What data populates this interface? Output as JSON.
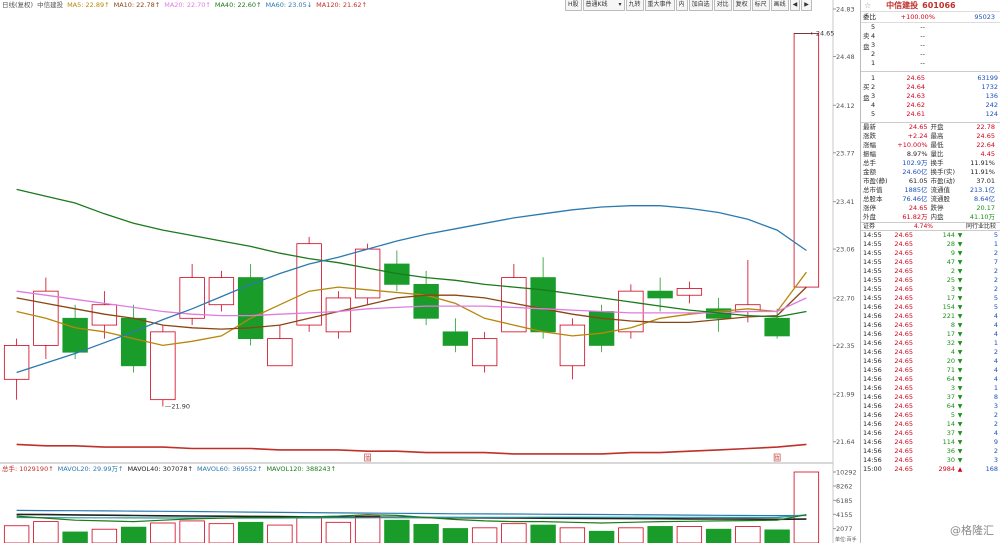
{
  "window": {
    "title": "日线(复权) 中信建投"
  },
  "legend_top": [
    {
      "text": "日线(复权)",
      "color": "#555555"
    },
    {
      "text": "中信建投",
      "color": "#555555"
    },
    {
      "text": "MA5: 22.89↑",
      "color": "#b8860b"
    },
    {
      "text": "MA10: 22.78↑",
      "color": "#8b4513"
    },
    {
      "text": "MA20: 22.70↑",
      "color": "#e07be0"
    },
    {
      "text": "MA40: 22.60↑",
      "color": "#1b7a1b"
    },
    {
      "text": "MA60: 23.05↓",
      "color": "#2a7ab0"
    },
    {
      "text": "MA120: 21.62↑",
      "color": "#c0302b"
    }
  ],
  "legend_bottom": [
    {
      "text": "总手: 1029190↑",
      "color": "#c0302b"
    },
    {
      "text": "MAVOL20: 29.99万↑",
      "color": "#2a7ab0"
    },
    {
      "text": "MAVOL40: 307078↑",
      "color": "#222222"
    },
    {
      "text": "MAVOL60: 369552↑",
      "color": "#2a7ab0"
    },
    {
      "text": "MAVOL120: 388243↑",
      "color": "#1b7a1b"
    }
  ],
  "toolbar": {
    "items": [
      "H股",
      "普通K线",
      "九转",
      "重大事件",
      "内",
      "加自选",
      "对比",
      "复权",
      "标尺",
      "画线",
      "◀",
      "▶"
    ]
  },
  "y_price_labels": [
    "24.83",
    "24.48",
    "24.12",
    "23.77",
    "23.41",
    "23.06",
    "22.70",
    "22.35",
    "21.99",
    "21.64"
  ],
  "y_vol_labels": [
    "10292",
    "8262",
    "6185",
    "4155",
    "2077",
    "单位:百手"
  ],
  "annotations": {
    "high": "24.65",
    "low": "21.90",
    "marker_a": "信",
    "marker_b": "信"
  },
  "chart_data": {
    "type": "candlestick",
    "price_range": [
      21.52,
      24.83
    ],
    "volume_range": [
      0,
      10292
    ],
    "candles": [
      {
        "o": 22.1,
        "c": 22.35,
        "h": 22.4,
        "l": 21.95,
        "v": 2500
      },
      {
        "o": 22.35,
        "c": 22.75,
        "h": 22.85,
        "l": 22.25,
        "v": 3100
      },
      {
        "o": 22.55,
        "c": 22.3,
        "h": 22.65,
        "l": 22.25,
        "v": 1600
      },
      {
        "o": 22.5,
        "c": 22.65,
        "h": 22.75,
        "l": 22.4,
        "v": 2000
      },
      {
        "o": 22.55,
        "c": 22.2,
        "h": 22.65,
        "l": 22.15,
        "v": 2300
      },
      {
        "o": 21.95,
        "c": 22.45,
        "h": 22.5,
        "l": 21.9,
        "v": 2900
      },
      {
        "o": 22.55,
        "c": 22.85,
        "h": 22.95,
        "l": 22.5,
        "v": 3200
      },
      {
        "o": 22.65,
        "c": 22.85,
        "h": 22.9,
        "l": 22.6,
        "v": 2800
      },
      {
        "o": 22.85,
        "c": 22.4,
        "h": 22.95,
        "l": 22.35,
        "v": 3000
      },
      {
        "o": 22.2,
        "c": 22.4,
        "h": 22.5,
        "l": 22.2,
        "v": 2600
      },
      {
        "o": 22.5,
        "c": 23.1,
        "h": 23.15,
        "l": 22.45,
        "v": 3600
      },
      {
        "o": 22.45,
        "c": 22.7,
        "h": 22.75,
        "l": 22.4,
        "v": 3000
      },
      {
        "o": 22.7,
        "c": 23.06,
        "h": 23.1,
        "l": 22.65,
        "v": 3900
      },
      {
        "o": 22.95,
        "c": 22.8,
        "h": 23.05,
        "l": 22.75,
        "v": 3300
      },
      {
        "o": 22.8,
        "c": 22.55,
        "h": 22.9,
        "l": 22.5,
        "v": 2700
      },
      {
        "o": 22.45,
        "c": 22.35,
        "h": 22.55,
        "l": 22.3,
        "v": 2100
      },
      {
        "o": 22.2,
        "c": 22.4,
        "h": 22.45,
        "l": 22.15,
        "v": 2200
      },
      {
        "o": 22.45,
        "c": 22.85,
        "h": 22.95,
        "l": 22.45,
        "v": 2800
      },
      {
        "o": 22.85,
        "c": 22.45,
        "h": 23.0,
        "l": 22.4,
        "v": 2600
      },
      {
        "o": 22.2,
        "c": 22.5,
        "h": 22.55,
        "l": 22.1,
        "v": 2200
      },
      {
        "o": 22.6,
        "c": 22.35,
        "h": 22.65,
        "l": 22.3,
        "v": 1700
      },
      {
        "o": 22.45,
        "c": 22.75,
        "h": 22.8,
        "l": 22.4,
        "v": 2200
      },
      {
        "o": 22.75,
        "c": 22.7,
        "h": 22.85,
        "l": 22.6,
        "v": 2400
      },
      {
        "o": 22.72,
        "c": 22.77,
        "h": 22.82,
        "l": 22.66,
        "v": 2400
      },
      {
        "o": 22.62,
        "c": 22.55,
        "h": 22.7,
        "l": 22.45,
        "v": 2000
      },
      {
        "o": 22.6,
        "c": 22.65,
        "h": 22.98,
        "l": 22.52,
        "v": 2400
      },
      {
        "o": 22.55,
        "c": 22.42,
        "h": 22.62,
        "l": 22.4,
        "v": 1900
      },
      {
        "o": 22.78,
        "c": 24.65,
        "h": 24.65,
        "l": 22.78,
        "v": 10292
      }
    ],
    "moving_averages": [
      {
        "name": "MA5",
        "color": "#b8860b",
        "values": [
          22.6,
          22.55,
          22.48,
          22.45,
          22.4,
          22.35,
          22.38,
          22.42,
          22.55,
          22.65,
          22.75,
          22.78,
          22.76,
          22.74,
          22.72,
          22.66,
          22.55,
          22.5,
          22.45,
          22.42,
          22.44,
          22.48,
          22.55,
          22.58,
          22.6,
          22.62,
          22.6,
          22.89
        ]
      },
      {
        "name": "MA10",
        "color": "#8b4513",
        "values": [
          22.7,
          22.66,
          22.62,
          22.58,
          22.55,
          22.5,
          22.48,
          22.47,
          22.48,
          22.5,
          22.55,
          22.6,
          22.65,
          22.7,
          22.72,
          22.72,
          22.7,
          22.66,
          22.62,
          22.58,
          22.55,
          22.53,
          22.52,
          22.52,
          22.54,
          22.56,
          22.57,
          22.78
        ]
      },
      {
        "name": "MA20",
        "color": "#e07be0",
        "values": [
          22.75,
          22.72,
          22.69,
          22.66,
          22.63,
          22.6,
          22.58,
          22.57,
          22.57,
          22.58,
          22.59,
          22.6,
          22.62,
          22.63,
          22.64,
          22.64,
          22.64,
          22.63,
          22.62,
          22.61,
          22.6,
          22.59,
          22.59,
          22.59,
          22.59,
          22.6,
          22.6,
          22.7
        ]
      },
      {
        "name": "MA40",
        "color": "#1b7a1b",
        "values": [
          23.5,
          23.45,
          23.4,
          23.32,
          23.25,
          23.2,
          23.16,
          23.12,
          23.08,
          23.03,
          22.99,
          22.96,
          22.92,
          22.88,
          22.85,
          22.83,
          22.8,
          22.78,
          22.76,
          22.73,
          22.7,
          22.67,
          22.64,
          22.61,
          22.59,
          22.57,
          22.56,
          22.6
        ]
      },
      {
        "name": "MA60",
        "color": "#2a7ab0",
        "values": [
          22.15,
          22.22,
          22.29,
          22.37,
          22.45,
          22.54,
          22.62,
          22.71,
          22.8,
          22.88,
          22.95,
          23.0,
          23.06,
          23.12,
          23.17,
          23.21,
          23.25,
          23.29,
          23.32,
          23.35,
          23.37,
          23.38,
          23.38,
          23.36,
          23.33,
          23.28,
          23.2,
          23.05
        ]
      },
      {
        "name": "MA120",
        "color": "#c0302b",
        "values": [
          21.62,
          21.61,
          21.61,
          21.6,
          21.6,
          21.6,
          21.59,
          21.59,
          21.59,
          21.58,
          21.58,
          21.58,
          21.57,
          21.57,
          21.56,
          21.56,
          21.56,
          21.55,
          21.55,
          21.55,
          21.55,
          21.56,
          21.56,
          21.57,
          21.58,
          21.59,
          21.6,
          21.62
        ]
      }
    ],
    "volume_averages": [
      {
        "name": "MAVOL20",
        "color": "#2a7ab0",
        "values": [
          4720,
          4700,
          4680,
          4650,
          4620,
          4590,
          4560,
          4520,
          4480,
          4440,
          4400,
          4360,
          4330,
          4300,
          4270,
          4240,
          4220,
          4200,
          4180,
          4150,
          4130,
          4100,
          4070,
          4040,
          4010,
          3990,
          3970,
          3990
        ]
      },
      {
        "name": "MAVOL40",
        "color": "#222222",
        "values": [
          4150,
          4110,
          4070,
          4030,
          3990,
          3950,
          3910,
          3880,
          3850,
          3820,
          3790,
          3760,
          3740,
          3720,
          3690,
          3670,
          3650,
          3620,
          3600,
          3580,
          3560,
          3540,
          3520,
          3500,
          3480,
          3460,
          3440,
          3470
        ]
      },
      {
        "name": "MAVOL60",
        "color": "#2a9a9a",
        "values": [
          3700,
          3680,
          3660,
          3650,
          3640,
          3630,
          3620,
          3620,
          3620,
          3630,
          3640,
          3650,
          3660,
          3680,
          3700,
          3710,
          3720,
          3730,
          3740,
          3740,
          3740,
          3740,
          3730,
          3720,
          3710,
          3700,
          3690,
          4070
        ]
      },
      {
        "name": "MAVOL120",
        "color": "#1b7a1b",
        "values": [
          3900,
          3600,
          3300,
          3200,
          3100,
          3300,
          3500,
          3600,
          3700,
          3700,
          3800,
          3900,
          4100,
          4000,
          3700,
          3400,
          3200,
          3100,
          3100,
          3000,
          2900,
          3000,
          3100,
          3150,
          3200,
          3250,
          3300,
          4100
        ]
      }
    ]
  },
  "quote": {
    "name": "中信建投",
    "code": "601066",
    "weibi_label": "委比",
    "weibi": "+100.00%",
    "weicha": "95023",
    "sell_label": "卖盘",
    "buy_label": "买盘",
    "sell": [
      {
        "lv": "5",
        "price": "--",
        "vol": ""
      },
      {
        "lv": "4",
        "price": "--",
        "vol": ""
      },
      {
        "lv": "3",
        "price": "--",
        "vol": ""
      },
      {
        "lv": "2",
        "price": "--",
        "vol": ""
      },
      {
        "lv": "1",
        "price": "--",
        "vol": ""
      }
    ],
    "buy": [
      {
        "lv": "1",
        "price": "24.65",
        "vol": "63199"
      },
      {
        "lv": "2",
        "price": "24.64",
        "vol": "1732"
      },
      {
        "lv": "3",
        "price": "24.63",
        "vol": "136"
      },
      {
        "lv": "4",
        "price": "24.62",
        "vol": "242"
      },
      {
        "lv": "5",
        "price": "24.61",
        "vol": "124"
      }
    ],
    "stats": [
      {
        "l1": "最新",
        "v1": "24.65",
        "c1": "r",
        "l2": "开盘",
        "v2": "22.78",
        "c2": "r"
      },
      {
        "l1": "涨跌",
        "v1": "+2.24",
        "c1": "r",
        "l2": "最高",
        "v2": "24.65",
        "c2": "r"
      },
      {
        "l1": "涨幅",
        "v1": "+10.00%",
        "c1": "r",
        "l2": "最低",
        "v2": "22.64",
        "c2": "r"
      },
      {
        "l1": "振幅",
        "v1": "8.97%",
        "c1": "k",
        "l2": "量比",
        "v2": "4.45",
        "c2": "r"
      },
      {
        "l1": "总手",
        "v1": "102.9万",
        "c1": "b",
        "l2": "换手",
        "v2": "11.91%",
        "c2": "k"
      },
      {
        "l1": "金额",
        "v1": "24.60亿",
        "c1": "b",
        "l2": "换手(实)",
        "v2": "11.91%",
        "c2": "k"
      },
      {
        "l1": "市盈(静)",
        "v1": "61.05",
        "c1": "k",
        "l2": "市盈(动)",
        "v2": "37.01",
        "c2": "k"
      },
      {
        "l1": "总市值",
        "v1": "1885亿",
        "c1": "b",
        "l2": "流通值",
        "v2": "213.1亿",
        "c2": "b"
      },
      {
        "l1": "总股本",
        "v1": "76.46亿",
        "c1": "b",
        "l2": "流通股",
        "v2": "8.64亿",
        "c2": "b"
      },
      {
        "l1": "涨停",
        "v1": "24.65",
        "c1": "r",
        "l2": "跌停",
        "v2": "20.17",
        "c2": "g"
      },
      {
        "l1": "外盘",
        "v1": "61.82万",
        "c1": "r",
        "l2": "内盘",
        "v2": "41.10万",
        "c2": "g"
      }
    ],
    "sector_label": "证券",
    "sector_pct": "4.74%",
    "sector_link": "同行业比较",
    "trades": [
      {
        "t": "14:55",
        "p": "24.65",
        "v": "144",
        "d": "down",
        "n": "5"
      },
      {
        "t": "14:55",
        "p": "24.65",
        "v": "28",
        "d": "down",
        "n": "1"
      },
      {
        "t": "14:55",
        "p": "24.65",
        "v": "9",
        "d": "down",
        "n": "2"
      },
      {
        "t": "14:55",
        "p": "24.65",
        "v": "47",
        "d": "down",
        "n": "7"
      },
      {
        "t": "14:55",
        "p": "24.65",
        "v": "2",
        "d": "down",
        "n": "2"
      },
      {
        "t": "14:55",
        "p": "24.65",
        "v": "25",
        "d": "down",
        "n": "2"
      },
      {
        "t": "14:55",
        "p": "24.65",
        "v": "3",
        "d": "down",
        "n": "2"
      },
      {
        "t": "14:55",
        "p": "24.65",
        "v": "17",
        "d": "down",
        "n": "5"
      },
      {
        "t": "14:56",
        "p": "24.65",
        "v": "154",
        "d": "down",
        "n": "5"
      },
      {
        "t": "14:56",
        "p": "24.65",
        "v": "221",
        "d": "down",
        "n": "4"
      },
      {
        "t": "14:56",
        "p": "24.65",
        "v": "8",
        "d": "down",
        "n": "4"
      },
      {
        "t": "14:56",
        "p": "24.65",
        "v": "17",
        "d": "down",
        "n": "4"
      },
      {
        "t": "14:56",
        "p": "24.65",
        "v": "32",
        "d": "down",
        "n": "1"
      },
      {
        "t": "14:56",
        "p": "24.65",
        "v": "4",
        "d": "down",
        "n": "2"
      },
      {
        "t": "14:56",
        "p": "24.65",
        "v": "20",
        "d": "down",
        "n": "4"
      },
      {
        "t": "14:56",
        "p": "24.65",
        "v": "71",
        "d": "down",
        "n": "4"
      },
      {
        "t": "14:56",
        "p": "24.65",
        "v": "64",
        "d": "down",
        "n": "4"
      },
      {
        "t": "14:56",
        "p": "24.65",
        "v": "3",
        "d": "down",
        "n": "1"
      },
      {
        "t": "14:56",
        "p": "24.65",
        "v": "37",
        "d": "down",
        "n": "8"
      },
      {
        "t": "14:56",
        "p": "24.65",
        "v": "64",
        "d": "down",
        "n": "3"
      },
      {
        "t": "14:56",
        "p": "24.65",
        "v": "5",
        "d": "down",
        "n": "2"
      },
      {
        "t": "14:56",
        "p": "24.65",
        "v": "14",
        "d": "down",
        "n": "2"
      },
      {
        "t": "14:56",
        "p": "24.65",
        "v": "37",
        "d": "down",
        "n": "4"
      },
      {
        "t": "14:56",
        "p": "24.65",
        "v": "114",
        "d": "down",
        "n": "9"
      },
      {
        "t": "14:56",
        "p": "24.65",
        "v": "36",
        "d": "down",
        "n": "2"
      },
      {
        "t": "14:56",
        "p": "24.65",
        "v": "30",
        "d": "down",
        "n": "3"
      },
      {
        "t": "15:00",
        "p": "24.65",
        "v": "2984",
        "d": "up",
        "n": "168"
      }
    ],
    "watermark": "@格隆汇"
  },
  "colors": {
    "up": "#d0021b",
    "down": "#1b8f1b",
    "up_candle": "#d0021b",
    "down_candle": "#1a9c2a"
  }
}
